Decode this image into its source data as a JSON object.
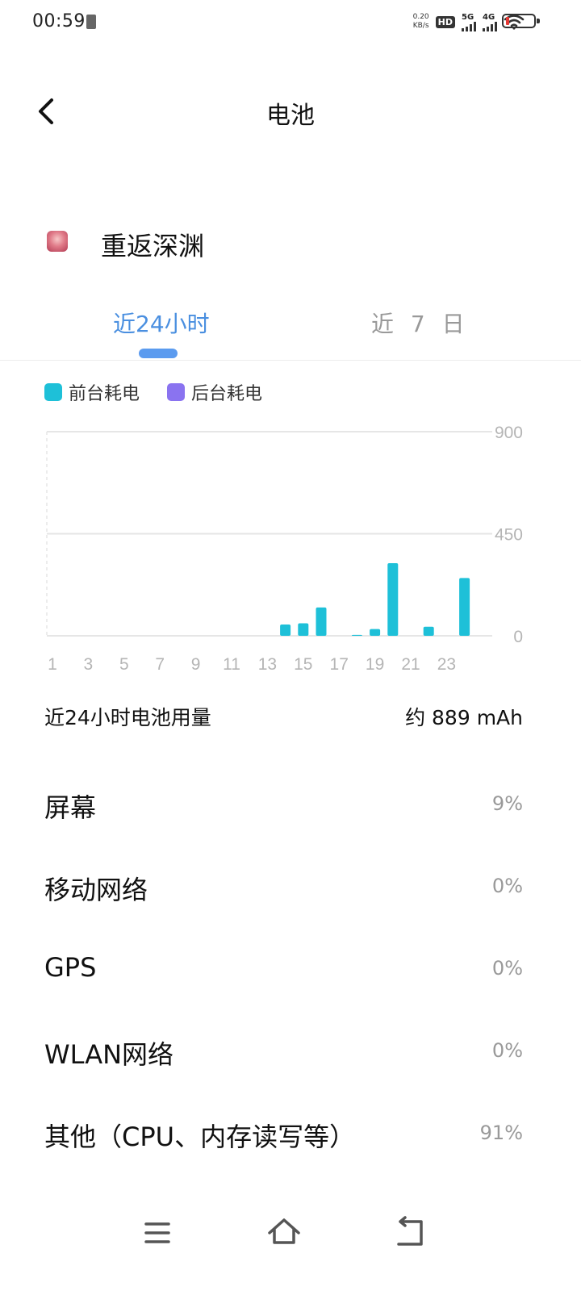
{
  "status_bar": {
    "time": "00:59",
    "net_speed_value": "0.20",
    "net_speed_unit": "KB/s",
    "hd_label": "HD",
    "sim1_tag": "5G",
    "sim2_tag": "4G",
    "battery_color": "#e53935"
  },
  "header": {
    "title": "电池",
    "back_icon": "chevron-left-icon"
  },
  "app": {
    "name": "重返深渊",
    "icon": "app-icon"
  },
  "tabs": [
    {
      "label": "近24小时",
      "active": true
    },
    {
      "label": "近 7 日",
      "active": false
    }
  ],
  "legend": [
    {
      "label": "前台耗电",
      "color": "#1ec0d8"
    },
    {
      "label": "后台耗电",
      "color": "#8a73f0"
    }
  ],
  "chart_data": {
    "type": "bar",
    "x": [
      1,
      2,
      3,
      4,
      5,
      6,
      7,
      8,
      9,
      10,
      11,
      12,
      13,
      14,
      15,
      16,
      17,
      18,
      19,
      20,
      21,
      22,
      23,
      24
    ],
    "x_tick_labels": [
      "1",
      "3",
      "5",
      "7",
      "9",
      "11",
      "13",
      "15",
      "17",
      "19",
      "21",
      "23"
    ],
    "series": [
      {
        "name": "前台耗电",
        "color": "#1ec0d8",
        "values": [
          0,
          0,
          0,
          0,
          0,
          0,
          0,
          0,
          0,
          0,
          0,
          0,
          0,
          50,
          55,
          125,
          0,
          4,
          30,
          320,
          0,
          40,
          0,
          255
        ]
      },
      {
        "name": "后台耗电",
        "color": "#8a73f0",
        "values": [
          0,
          0,
          0,
          0,
          0,
          0,
          0,
          0,
          0,
          0,
          0,
          0,
          0,
          0,
          0,
          0,
          0,
          0,
          0,
          0,
          0,
          0,
          0,
          0
        ]
      }
    ],
    "y_tick_labels": [
      "900",
      "450",
      "0"
    ],
    "ylim": [
      0,
      900
    ],
    "grid": true
  },
  "summary": {
    "label": "近24小时电池用量",
    "value": "约 889 mAh"
  },
  "breakdown": [
    {
      "label": "屏幕",
      "percent": "9%"
    },
    {
      "label": "移动网络",
      "percent": "0%"
    },
    {
      "label": "GPS",
      "percent": "0%"
    },
    {
      "label": "WLAN网络",
      "percent": "0%"
    },
    {
      "label": "其他（CPU、内存读写等）",
      "percent": "91%"
    }
  ],
  "nav_bar": {
    "menu_icon": "menu-icon",
    "home_icon": "home-icon",
    "back_icon": "back-arrow-icon"
  }
}
